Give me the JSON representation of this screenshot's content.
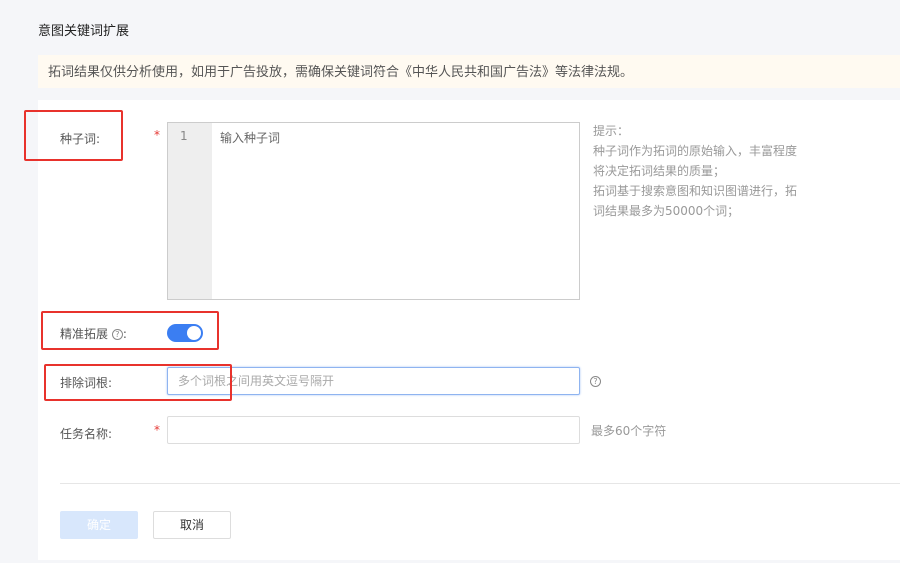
{
  "page": {
    "title": "意图关键词扩展",
    "notice": "拓词结果仅供分析使用，如用于广告投放，需确保关键词符合《中华人民共和国广告法》等法律法规。"
  },
  "form": {
    "seed": {
      "label": "种子词:",
      "required": "*",
      "line_number": "1",
      "placeholder": "输入种子词",
      "hint": [
        "提示：",
        "种子词作为拓词的原始输入，丰富程度",
        "将决定拓词结果的质量；",
        "拓词基于搜索意图和知识图谱进行，拓",
        "词结果最多为50000个词；"
      ]
    },
    "precise": {
      "label": "精准拓展",
      "help": "?",
      "colon": ":",
      "enabled": true
    },
    "exclude": {
      "label": "排除词根:",
      "placeholder": "多个词根之间用英文逗号隔开",
      "help": "?"
    },
    "task_name": {
      "label": "任务名称:",
      "required": "*",
      "hint": "最多60个字符",
      "value": ""
    }
  },
  "buttons": {
    "confirm": "确定",
    "cancel": "取消"
  },
  "colors": {
    "accent": "#3b7ef2",
    "highlight": "#e8322c"
  }
}
